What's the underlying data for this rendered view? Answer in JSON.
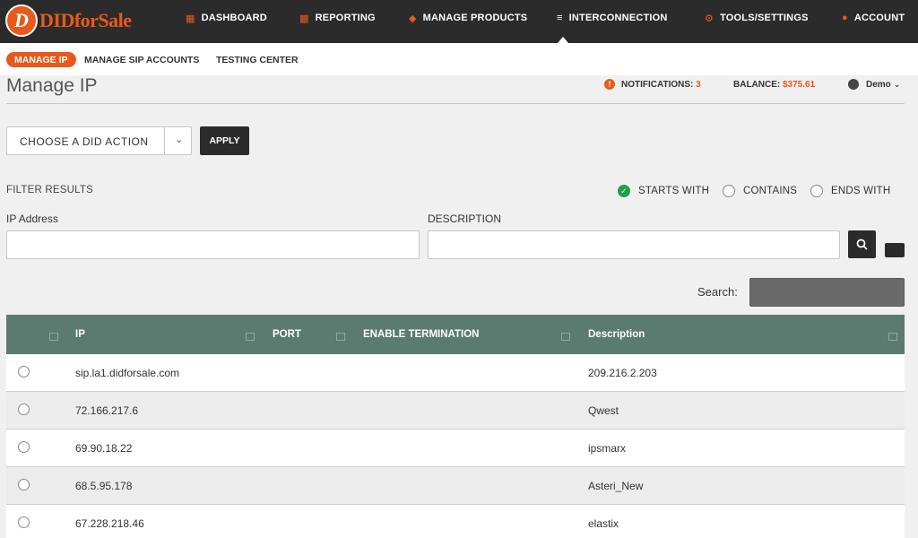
{
  "brand": {
    "logo_letter": "D",
    "name_did": "DID",
    "name_rest": "forSale"
  },
  "nav": {
    "items": [
      {
        "label": "DASHBOARD",
        "icon": "grid-icon"
      },
      {
        "label": "REPORTING",
        "icon": "chart-icon"
      },
      {
        "label": "MANAGE PRODUCTS",
        "icon": "products-icon"
      },
      {
        "label": "INTERCONNECTION",
        "icon": "sliders-icon"
      },
      {
        "label": "TOOLS/SETTINGS",
        "icon": "gear-icon"
      },
      {
        "label": "ACCOUNT",
        "icon": "user-icon"
      }
    ]
  },
  "subnav": {
    "items": [
      {
        "label": "MANAGE IP"
      },
      {
        "label": "MANAGE SIP ACCOUNTS"
      },
      {
        "label": "TESTING CENTER"
      }
    ]
  },
  "header": {
    "title": "Manage IP",
    "notifications_label": "NOTIFICATIONS:",
    "notifications_count": "3",
    "balance_label": "BALANCE:",
    "balance_value": "$375.61",
    "user": "Demo"
  },
  "actions": {
    "select_label": "CHOOSE A DID ACTION",
    "apply_label": "APPLY"
  },
  "filter": {
    "title": "FILTER RESULTS",
    "options": [
      "STARTS WITH",
      "CONTAINS",
      "ENDS WITH"
    ],
    "selected": "STARTS WITH",
    "ip_label": "IP Address",
    "desc_label": "DESCRIPTION",
    "ip_value": "",
    "desc_value": ""
  },
  "search": {
    "label": "Search:",
    "value": ""
  },
  "table": {
    "columns": [
      "IP",
      "PORT",
      "ENABLE TERMINATION",
      "Description"
    ],
    "rows": [
      {
        "ip": "sip.la1.didforsale.com",
        "port": "",
        "termination": "",
        "description": "209.216.2.203"
      },
      {
        "ip": "72.166.217.6",
        "port": "",
        "termination": "",
        "description": "Qwest"
      },
      {
        "ip": "69.90.18.22",
        "port": "",
        "termination": "",
        "description": "ipsmarx"
      },
      {
        "ip": "68.5.95.178",
        "port": "",
        "termination": "",
        "description": "Asteri_New"
      },
      {
        "ip": "67.228.218.46",
        "port": "",
        "termination": "",
        "description": "elastix"
      }
    ]
  },
  "colors": {
    "accent": "#e85a1c",
    "nav_bg": "#2b2b2b",
    "table_header": "#5b7a70",
    "success": "#1ea04a"
  }
}
